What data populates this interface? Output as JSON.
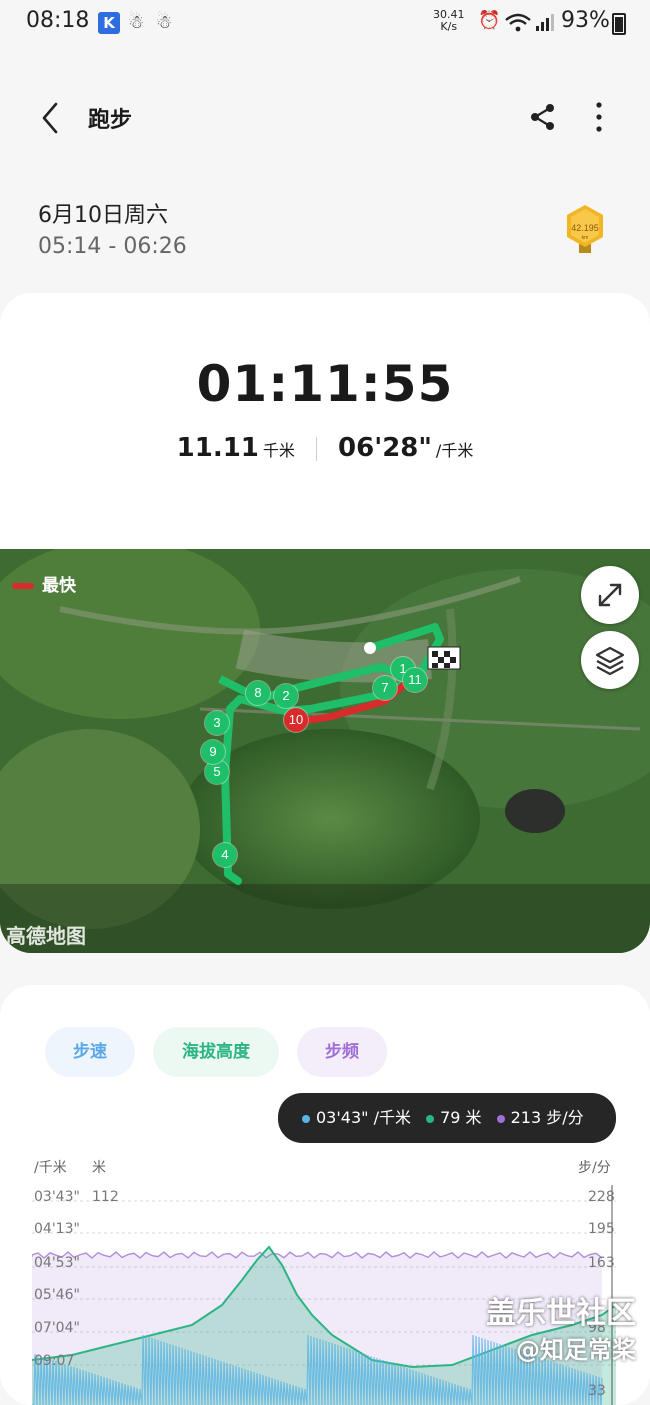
{
  "status_bar": {
    "time": "08:18",
    "app_badge": "K",
    "net_speed_value": "30.41",
    "net_speed_unit": "K/s",
    "battery": "93%"
  },
  "header": {
    "title": "跑步"
  },
  "session": {
    "date": "6月10日周六",
    "time_range": "05:14 - 06:26",
    "medal_label": "42.195",
    "medal_unit": "km"
  },
  "summary": {
    "duration": "01:11:55",
    "distance": "11.11",
    "distance_unit": "千米",
    "pace": "06'28\"",
    "pace_unit": "/千米"
  },
  "map": {
    "legend_label": "最快",
    "provider_watermark": "高德地图",
    "km_markers": [
      "1",
      "2",
      "3",
      "4",
      "5",
      "7",
      "8",
      "9",
      "10",
      "11"
    ],
    "colors": {
      "route": "#1fbf6a",
      "fastest": "#d92b2b"
    }
  },
  "tabs": [
    {
      "label": "步速",
      "color": "#5aa8e6"
    },
    {
      "label": "海拔高度",
      "color": "#2bb584"
    },
    {
      "label": "步频",
      "color": "#a070d6"
    }
  ],
  "tooltip": {
    "pace": "03'43\" /千米",
    "altitude": "79 米",
    "cadence": "213 步/分"
  },
  "chart_data": {
    "type": "line",
    "left_axis_labels": {
      "pace_unit": "/千米",
      "altitude_unit": "米"
    },
    "right_axis_label": "步/分",
    "y_ticks_pace": [
      "03'43\"",
      "04'13\"",
      "04'53\"",
      "05'46\"",
      "07'04\"",
      "09:07"
    ],
    "y_tick_altitude_top": "112",
    "y_ticks_cadence": [
      "228",
      "195",
      "163",
      "98",
      "33"
    ],
    "series": [
      {
        "name": "步速",
        "color": "#5ab4e6"
      },
      {
        "name": "海拔高度",
        "color": "#2bb584"
      },
      {
        "name": "步频",
        "color": "#a070d6"
      }
    ]
  },
  "page_watermark": {
    "line1": "盖乐世社区",
    "line2": "@知足常桨"
  }
}
